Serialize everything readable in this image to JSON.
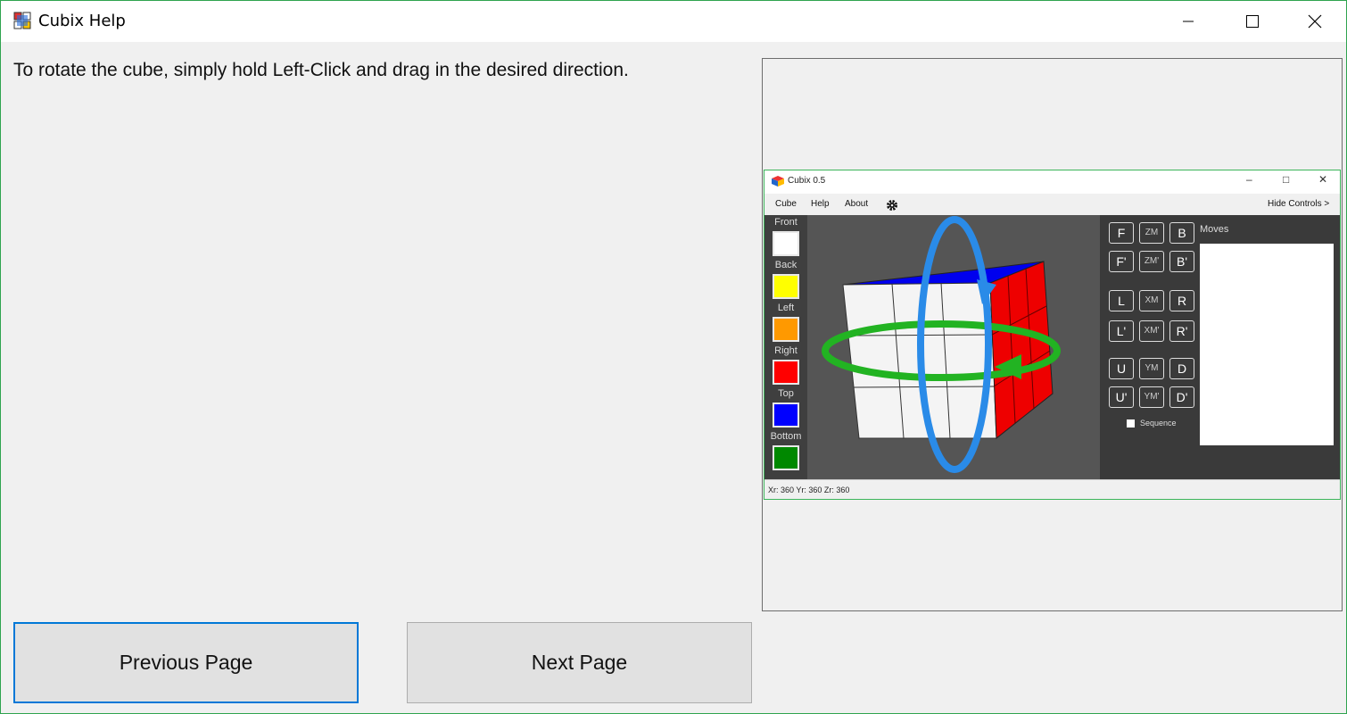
{
  "window": {
    "title": "Cubix Help"
  },
  "help": {
    "text": "To rotate the cube, simply hold Left-Click and drag in the desired direction."
  },
  "preview": {
    "title": "Cubix 0.5",
    "menu": [
      "Cube",
      "Help",
      "About"
    ],
    "hide_controls": "Hide Controls >",
    "faces": [
      {
        "label": "Front",
        "color": "#ffffff"
      },
      {
        "label": "Back",
        "color": "#ffff00"
      },
      {
        "label": "Left",
        "color": "#ff9900"
      },
      {
        "label": "Right",
        "color": "#ff0000"
      },
      {
        "label": "Top",
        "color": "#0000ff"
      },
      {
        "label": "Bottom",
        "color": "#008000"
      }
    ],
    "moves_label": "Moves",
    "sequence_label": "Sequence",
    "status": "Xr: 360   Yr: 360   Zr: 360",
    "buttons": [
      [
        "F",
        "ZM",
        "B"
      ],
      [
        "F'",
        "ZM'",
        "B'"
      ],
      [
        "L",
        "XM",
        "R"
      ],
      [
        "L'",
        "XM'",
        "R'"
      ],
      [
        "U",
        "YM",
        "D"
      ],
      [
        "U'",
        "YM'",
        "D'"
      ]
    ]
  },
  "nav": {
    "prev_label": "Previous Page",
    "next_label": "Next Page"
  },
  "colors": {
    "accent": "#0078d7",
    "window_border": "#2fa44f"
  }
}
